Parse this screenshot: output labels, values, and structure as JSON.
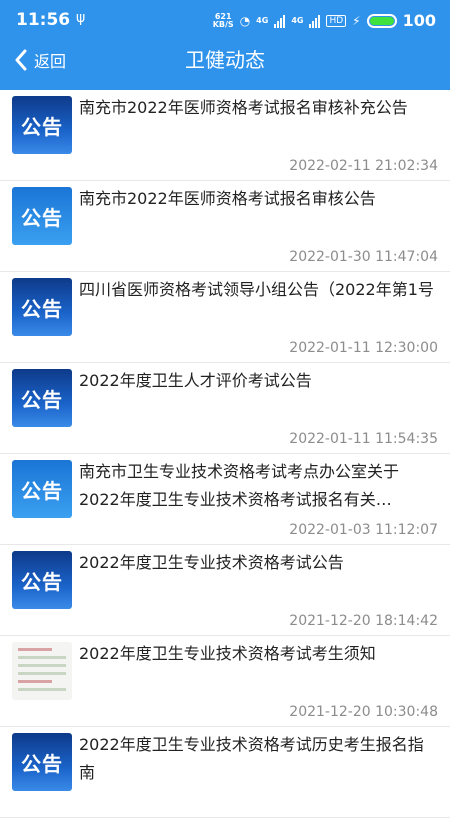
{
  "status_bar": {
    "time": "11:56",
    "network_speed": "621",
    "network_unit": "KB/S",
    "battery_level": "100",
    "network_tag_1": "4G",
    "network_tag_2": "4G",
    "hd_tag": "HD"
  },
  "nav": {
    "back_label": "返回",
    "title": "卫健动态"
  },
  "items": [
    {
      "title": "南充市2022年医师资格考试报名审核补充公告",
      "date": "2022-02-11 21:02:34",
      "thumb": "公告"
    },
    {
      "title": "南充市2022年医师资格考试报名审核公告",
      "date": "2022-01-30 11:47:04",
      "thumb": "公告"
    },
    {
      "title": "四川省医师资格考试领导小组公告（2022年第1号",
      "date": "2022-01-11 12:30:00",
      "thumb": "公告"
    },
    {
      "title": "2022年度卫生人才评价考试公告",
      "date": "2022-01-11 11:54:35",
      "thumb": "公告"
    },
    {
      "title": "南充市卫生专业技术资格考试考点办公室关于2022年度卫生专业技术资格考试报名有关…",
      "date": "2022-01-03 11:12:07",
      "thumb": "公告"
    },
    {
      "title": "2022年度卫生专业技术资格考试公告",
      "date": "2021-12-20 18:14:42",
      "thumb": "公告"
    },
    {
      "title": "2022年度卫生专业技术资格考试考生须知",
      "date": "2021-12-20 10:30:48",
      "thumb": ""
    },
    {
      "title": "2022年度卫生专业技术资格考试历史考生报名指南",
      "date": "",
      "thumb": "公告"
    }
  ]
}
